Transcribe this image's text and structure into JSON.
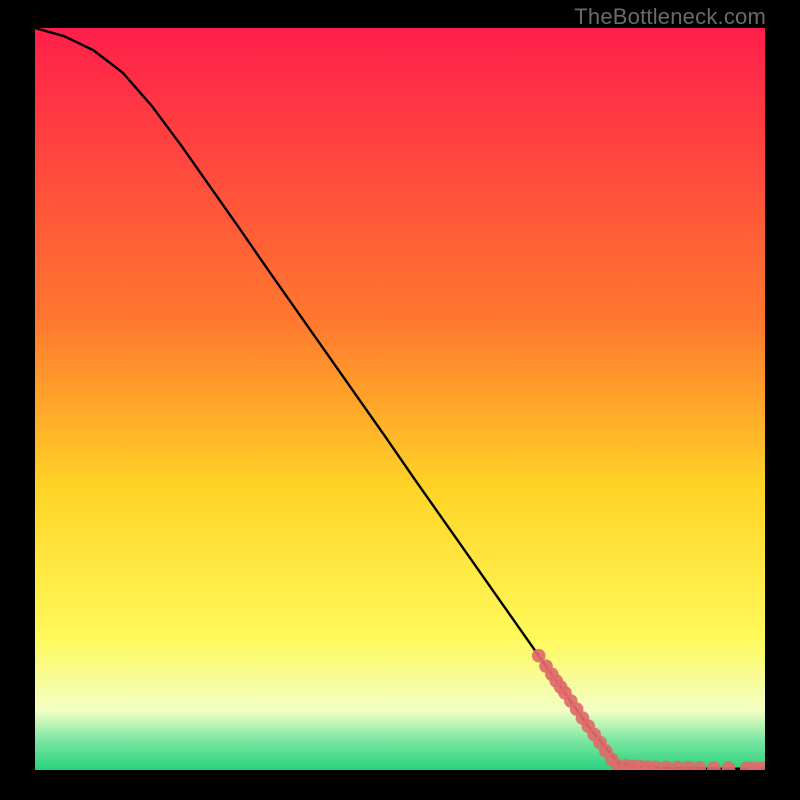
{
  "watermark": "TheBottleneck.com",
  "colors": {
    "gradient_top": "#ff1e4b",
    "gradient_mid1": "#ff7a2e",
    "gradient_mid2": "#ffd426",
    "gradient_mid3": "#fff95a",
    "gradient_bottom1": "#f2ffc4",
    "gradient_bottom2": "#7ae6a2",
    "gradient_bottom3": "#29d17c",
    "curve": "#000000",
    "marker": "#e06a6a"
  },
  "chart_data": {
    "type": "line",
    "title": "",
    "xlabel": "",
    "ylabel": "",
    "xlim": [
      0,
      100
    ],
    "ylim": [
      0,
      100
    ],
    "grid": false,
    "legend": false,
    "series": [
      {
        "name": "curve",
        "x": [
          0,
          4,
          8,
          12,
          16,
          20,
          24,
          28,
          32,
          36,
          40,
          44,
          48,
          52,
          56,
          60,
          64,
          68,
          72,
          76,
          80,
          82,
          84,
          86,
          88,
          90,
          92,
          94,
          96,
          98,
          100
        ],
        "y": [
          100.0,
          98.9,
          97.0,
          94.0,
          89.5,
          84.2,
          78.6,
          73.0,
          67.3,
          61.7,
          56.1,
          50.5,
          44.9,
          39.2,
          33.6,
          28.0,
          22.4,
          16.8,
          11.2,
          5.6,
          0.85,
          0.58,
          0.4,
          0.3,
          0.25,
          0.22,
          0.2,
          0.18,
          0.17,
          0.17,
          0.17
        ]
      }
    ],
    "markers": {
      "name": "highlight-points",
      "x": [
        69.0,
        70.0,
        70.8,
        71.4,
        72.0,
        72.6,
        73.4,
        74.2,
        75.0,
        75.8,
        76.6,
        77.4,
        78.2,
        79.0,
        79.8,
        81.0,
        82.0,
        83.0,
        84.0,
        85.0,
        86.5,
        88.0,
        89.5,
        91.0,
        93.0,
        95.0,
        97.5,
        98.5,
        99.5
      ],
      "y": [
        15.4,
        14.0,
        12.9,
        12.0,
        11.2,
        10.4,
        9.3,
        8.2,
        7.0,
        5.9,
        4.8,
        3.7,
        2.55,
        1.45,
        0.6,
        0.55,
        0.5,
        0.45,
        0.4,
        0.37,
        0.35,
        0.33,
        0.31,
        0.3,
        0.28,
        0.26,
        0.24,
        0.23,
        0.22
      ]
    },
    "annotations": []
  }
}
